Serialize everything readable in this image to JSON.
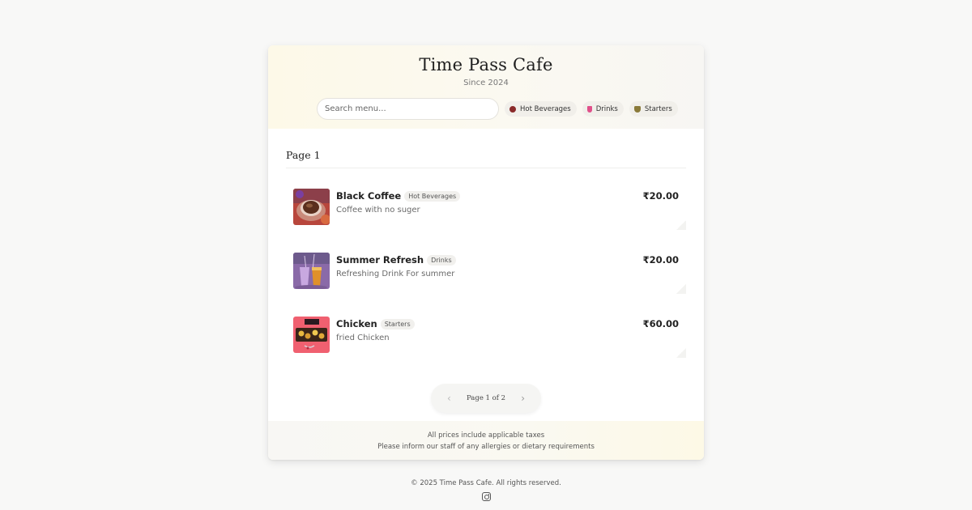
{
  "header": {
    "title": "Time Pass Cafe",
    "since": "Since 2024",
    "search_placeholder": "Search menu...",
    "categories": [
      {
        "label": "Hot Beverages",
        "icon": "coffee-cup-icon",
        "color": "#8a2a2a"
      },
      {
        "label": "Drinks",
        "icon": "drink-glass-icon",
        "color": "#e0508a"
      },
      {
        "label": "Starters",
        "icon": "bowl-icon",
        "color": "#8a7a3a"
      }
    ]
  },
  "main": {
    "page_heading": "Page 1",
    "items": [
      {
        "name": "Black Coffee",
        "category": "Hot Beverages",
        "description": "Coffee with no suger",
        "price": "₹20.00",
        "image": "coffee-photo"
      },
      {
        "name": "Summer Refresh",
        "category": "Drinks",
        "description": "Refreshing Drink For summer",
        "price": "₹20.00",
        "image": "drinks-photo"
      },
      {
        "name": "Chicken",
        "category": "Starters",
        "description": "fried Chicken",
        "price": "₹60.00",
        "image": "chicken-photo"
      }
    ],
    "pagination": {
      "label": "Page 1 of 2",
      "prev_icon": "chevron-left-icon",
      "next_icon": "chevron-right-icon"
    }
  },
  "footer": {
    "line1": "All prices include applicable taxes",
    "line2": "Please inform our staff of any allergies or dietary requirements"
  },
  "page_footer": {
    "copyright": "© 2025 Time Pass Cafe. All rights reserved.",
    "social_icon": "instagram-icon"
  }
}
